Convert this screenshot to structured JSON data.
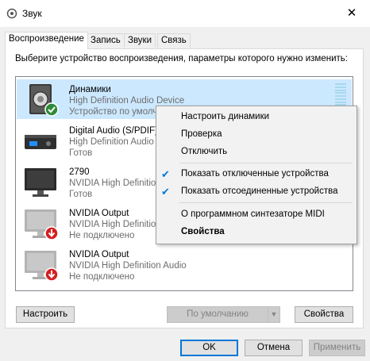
{
  "window": {
    "title": "Звук",
    "close_glyph": "✕"
  },
  "tabs": [
    {
      "label": "Воспроизведение",
      "active": true
    },
    {
      "label": "Запись"
    },
    {
      "label": "Звуки"
    },
    {
      "label": "Связь"
    }
  ],
  "instruction": "Выберите устройство воспроизведения, параметры которого нужно изменить:",
  "devices": [
    {
      "name": "Динамики",
      "desc": "High Definition Audio Device",
      "status": "Устройство по умолч",
      "icon": "speaker-icon",
      "badge": "default-check-badge"
    },
    {
      "name": "Digital Audio (S/PDIF)",
      "desc": "High Definition Audio",
      "status": "Готов",
      "icon": "digital-audio-icon"
    },
    {
      "name": "2790",
      "desc": "NVIDIA High Definition",
      "status": "Готов",
      "icon": "monitor-icon"
    },
    {
      "name": "NVIDIA Output",
      "desc": "NVIDIA High Definition",
      "status": "Не подключено",
      "icon": "monitor-icon",
      "badge": "disconnected-arrow-badge"
    },
    {
      "name": "NVIDIA Output",
      "desc": "NVIDIA High Definition Audio",
      "status": "Не подключено",
      "icon": "monitor-icon",
      "badge": "disconnected-arrow-badge"
    }
  ],
  "context_menu": {
    "configure": "Настроить динамики",
    "test": "Проверка",
    "disable": "Отключить",
    "show_disabled": "Показать отключенные устройства",
    "show_disconnected": "Показать отсоединенные устройства",
    "about_midi": "О программном синтезаторе MIDI",
    "properties": "Свойства",
    "check_glyph": "✔"
  },
  "buttons": {
    "configure": "Настроить",
    "set_default": "По умолчанию",
    "properties": "Свойства",
    "ok": "OK",
    "cancel": "Отмена",
    "apply": "Применить",
    "split_arrow_glyph": "▼"
  },
  "colors": {
    "selection": "#cce8ff",
    "accent": "#0078d7",
    "check_badge": "#2e8b3a",
    "disconnected_badge": "#d41f1f"
  }
}
